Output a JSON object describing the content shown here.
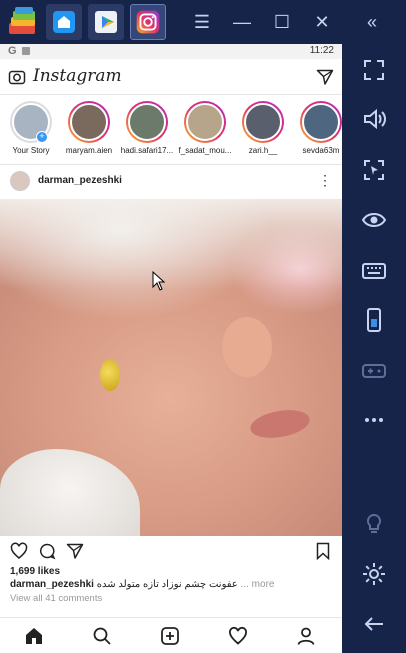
{
  "emulator": {
    "window_controls": [
      "menu-icon",
      "minimize-icon",
      "maximize-icon",
      "close-icon"
    ],
    "collapse_icon": "double-chevron-left-icon",
    "sidebar_icons": [
      "fullscreen-icon",
      "volume-icon",
      "screenshot-icon",
      "eye-icon",
      "keyboard-icon",
      "phone-icon",
      "gamepad-icon",
      "more-icon",
      "bulb-icon",
      "settings-icon",
      "back-arrow-icon"
    ]
  },
  "statusbar": {
    "time": "11:22",
    "g": "G"
  },
  "header": {
    "wordmark": "Instagram"
  },
  "stories": [
    {
      "name": "Your Story",
      "own": true,
      "color": "#a9b4c2"
    },
    {
      "name": "maryam.aien",
      "color": "#7a6a5e"
    },
    {
      "name": "hadi.safari17...",
      "color": "#6b7a6a"
    },
    {
      "name": "f_sadat_mou...",
      "color": "#b6a58a"
    },
    {
      "name": "zari.h__",
      "color": "#5a5f6e"
    },
    {
      "name": "sevda63m",
      "color": "#4f6680"
    }
  ],
  "post": {
    "username": "darman_pezeshki",
    "likes": "1,699 likes",
    "caption_user": "darman_pezeshki",
    "caption_text": "عفونت چشم نوزاد تازه متولد شده",
    "caption_more": "... more",
    "comments": "View all 41 comments"
  },
  "colors": {
    "emulator_bg": "#16244a",
    "accent_blue": "#3897f0"
  }
}
